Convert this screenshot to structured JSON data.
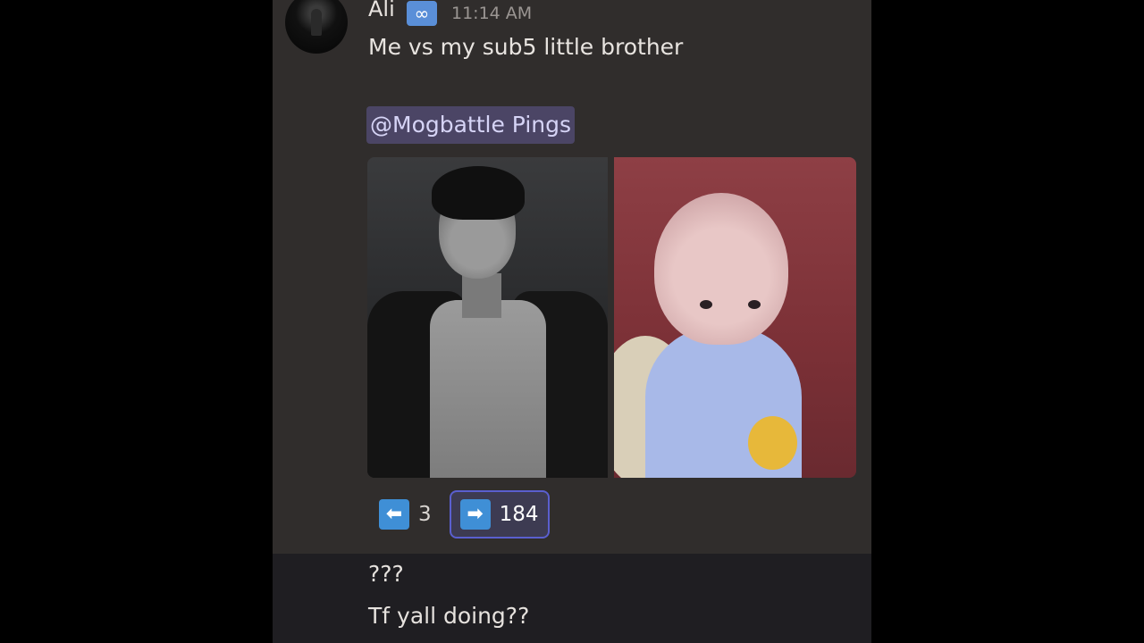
{
  "message": {
    "author": "Ali",
    "author_badge": "∞",
    "timestamp": "11:14 AM",
    "text": "Me vs my sub5 little brother",
    "mention": "@Mogbattle Pings",
    "attachments": [
      {
        "name": "left-photo",
        "icon": "photo"
      },
      {
        "name": "right-photo",
        "icon": "photo"
      }
    ]
  },
  "reactions": [
    {
      "emoji": "⬅",
      "count": "3",
      "selected": false
    },
    {
      "emoji": "➡",
      "count": "184",
      "selected": true
    }
  ],
  "followups": [
    {
      "text": "???"
    },
    {
      "text": "Tf yall doing??"
    }
  ],
  "colors": {
    "background": "#000000",
    "panel": "#302d2c",
    "panel_lower": "#1f1e22",
    "mention_bg": "#4b4565",
    "reaction_selected_border": "#5a5fcf",
    "emoji_blue": "#3f8fd6"
  }
}
